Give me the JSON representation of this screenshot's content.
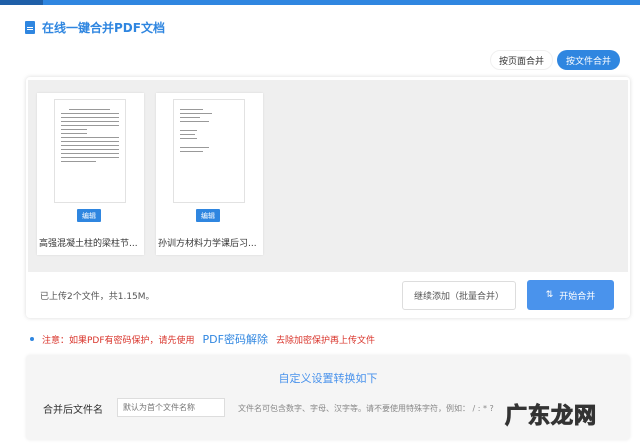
{
  "header": {
    "title": "在线一键合并PDF文档"
  },
  "mode": {
    "by_page": "按页面合并",
    "by_file": "按文件合并"
  },
  "files": [
    {
      "name": "高强混凝土柱的梁柱节...",
      "edit": "编辑"
    },
    {
      "name": "孙训方材料力学课后习...",
      "edit": "编辑"
    }
  ],
  "status": "已上传2个文件，共1.15M。",
  "buttons": {
    "add": "继续添加（批量合并）",
    "start": "开始合并"
  },
  "note": {
    "prefix": "注意：如果PDF有密码保护，请先使用",
    "link": "PDF密码解除",
    "suffix": "去除加密保护再上传文件"
  },
  "settings": {
    "title": "自定义设置转换如下",
    "label": "合并后文件名",
    "placeholder": "默认为首个文件名称",
    "hint": "文件名可包含数字、字母、汉字等。请不要使用特殊字符，例如： / : * ?"
  },
  "watermark": "广东龙网"
}
